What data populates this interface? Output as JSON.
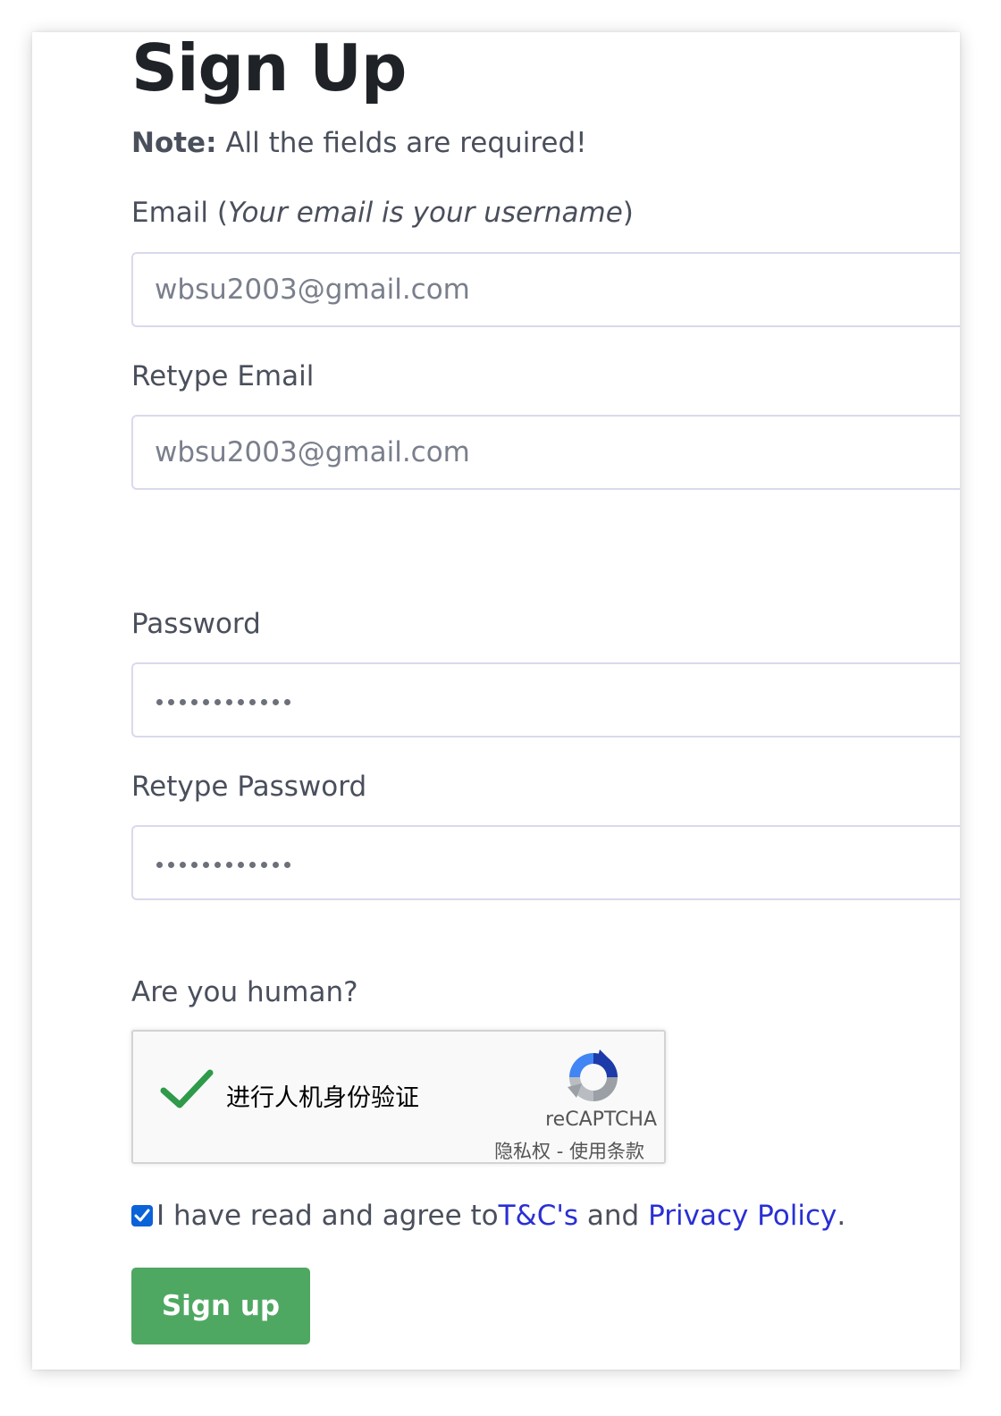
{
  "form": {
    "title": "Sign Up",
    "note_label": "Note:",
    "note_text": " All the fields are required!",
    "email": {
      "label_prefix": "Email (",
      "label_hint": "Your email is your username",
      "label_suffix": ")",
      "value": "wbsu2003@gmail.com"
    },
    "retype_email": {
      "label": "Retype Email",
      "value": "wbsu2003@gmail.com"
    },
    "password": {
      "label": "Password",
      "masked_length": 12
    },
    "retype_password": {
      "label": "Retype Password",
      "masked_length": 12
    },
    "human_check": {
      "label": "Are you human?",
      "captcha_text": "进行人机身份验证",
      "brand": "reCAPTCHA",
      "links": "隐私权 - 使用条款",
      "checked": true,
      "check_color": "#2e9a4a"
    },
    "agreement": {
      "checked": true,
      "text_before": "I have read and agree to",
      "terms_link": "T&C's",
      "text_middle": " and ",
      "privacy_link": "Privacy Policy",
      "text_after": "."
    },
    "submit_label": "Sign up"
  },
  "colors": {
    "accent_button": "#4ea862",
    "link": "#2a2fd4",
    "checkbox": "#0b63d8",
    "text": "#4a4f5c",
    "heading": "#1f2328"
  }
}
